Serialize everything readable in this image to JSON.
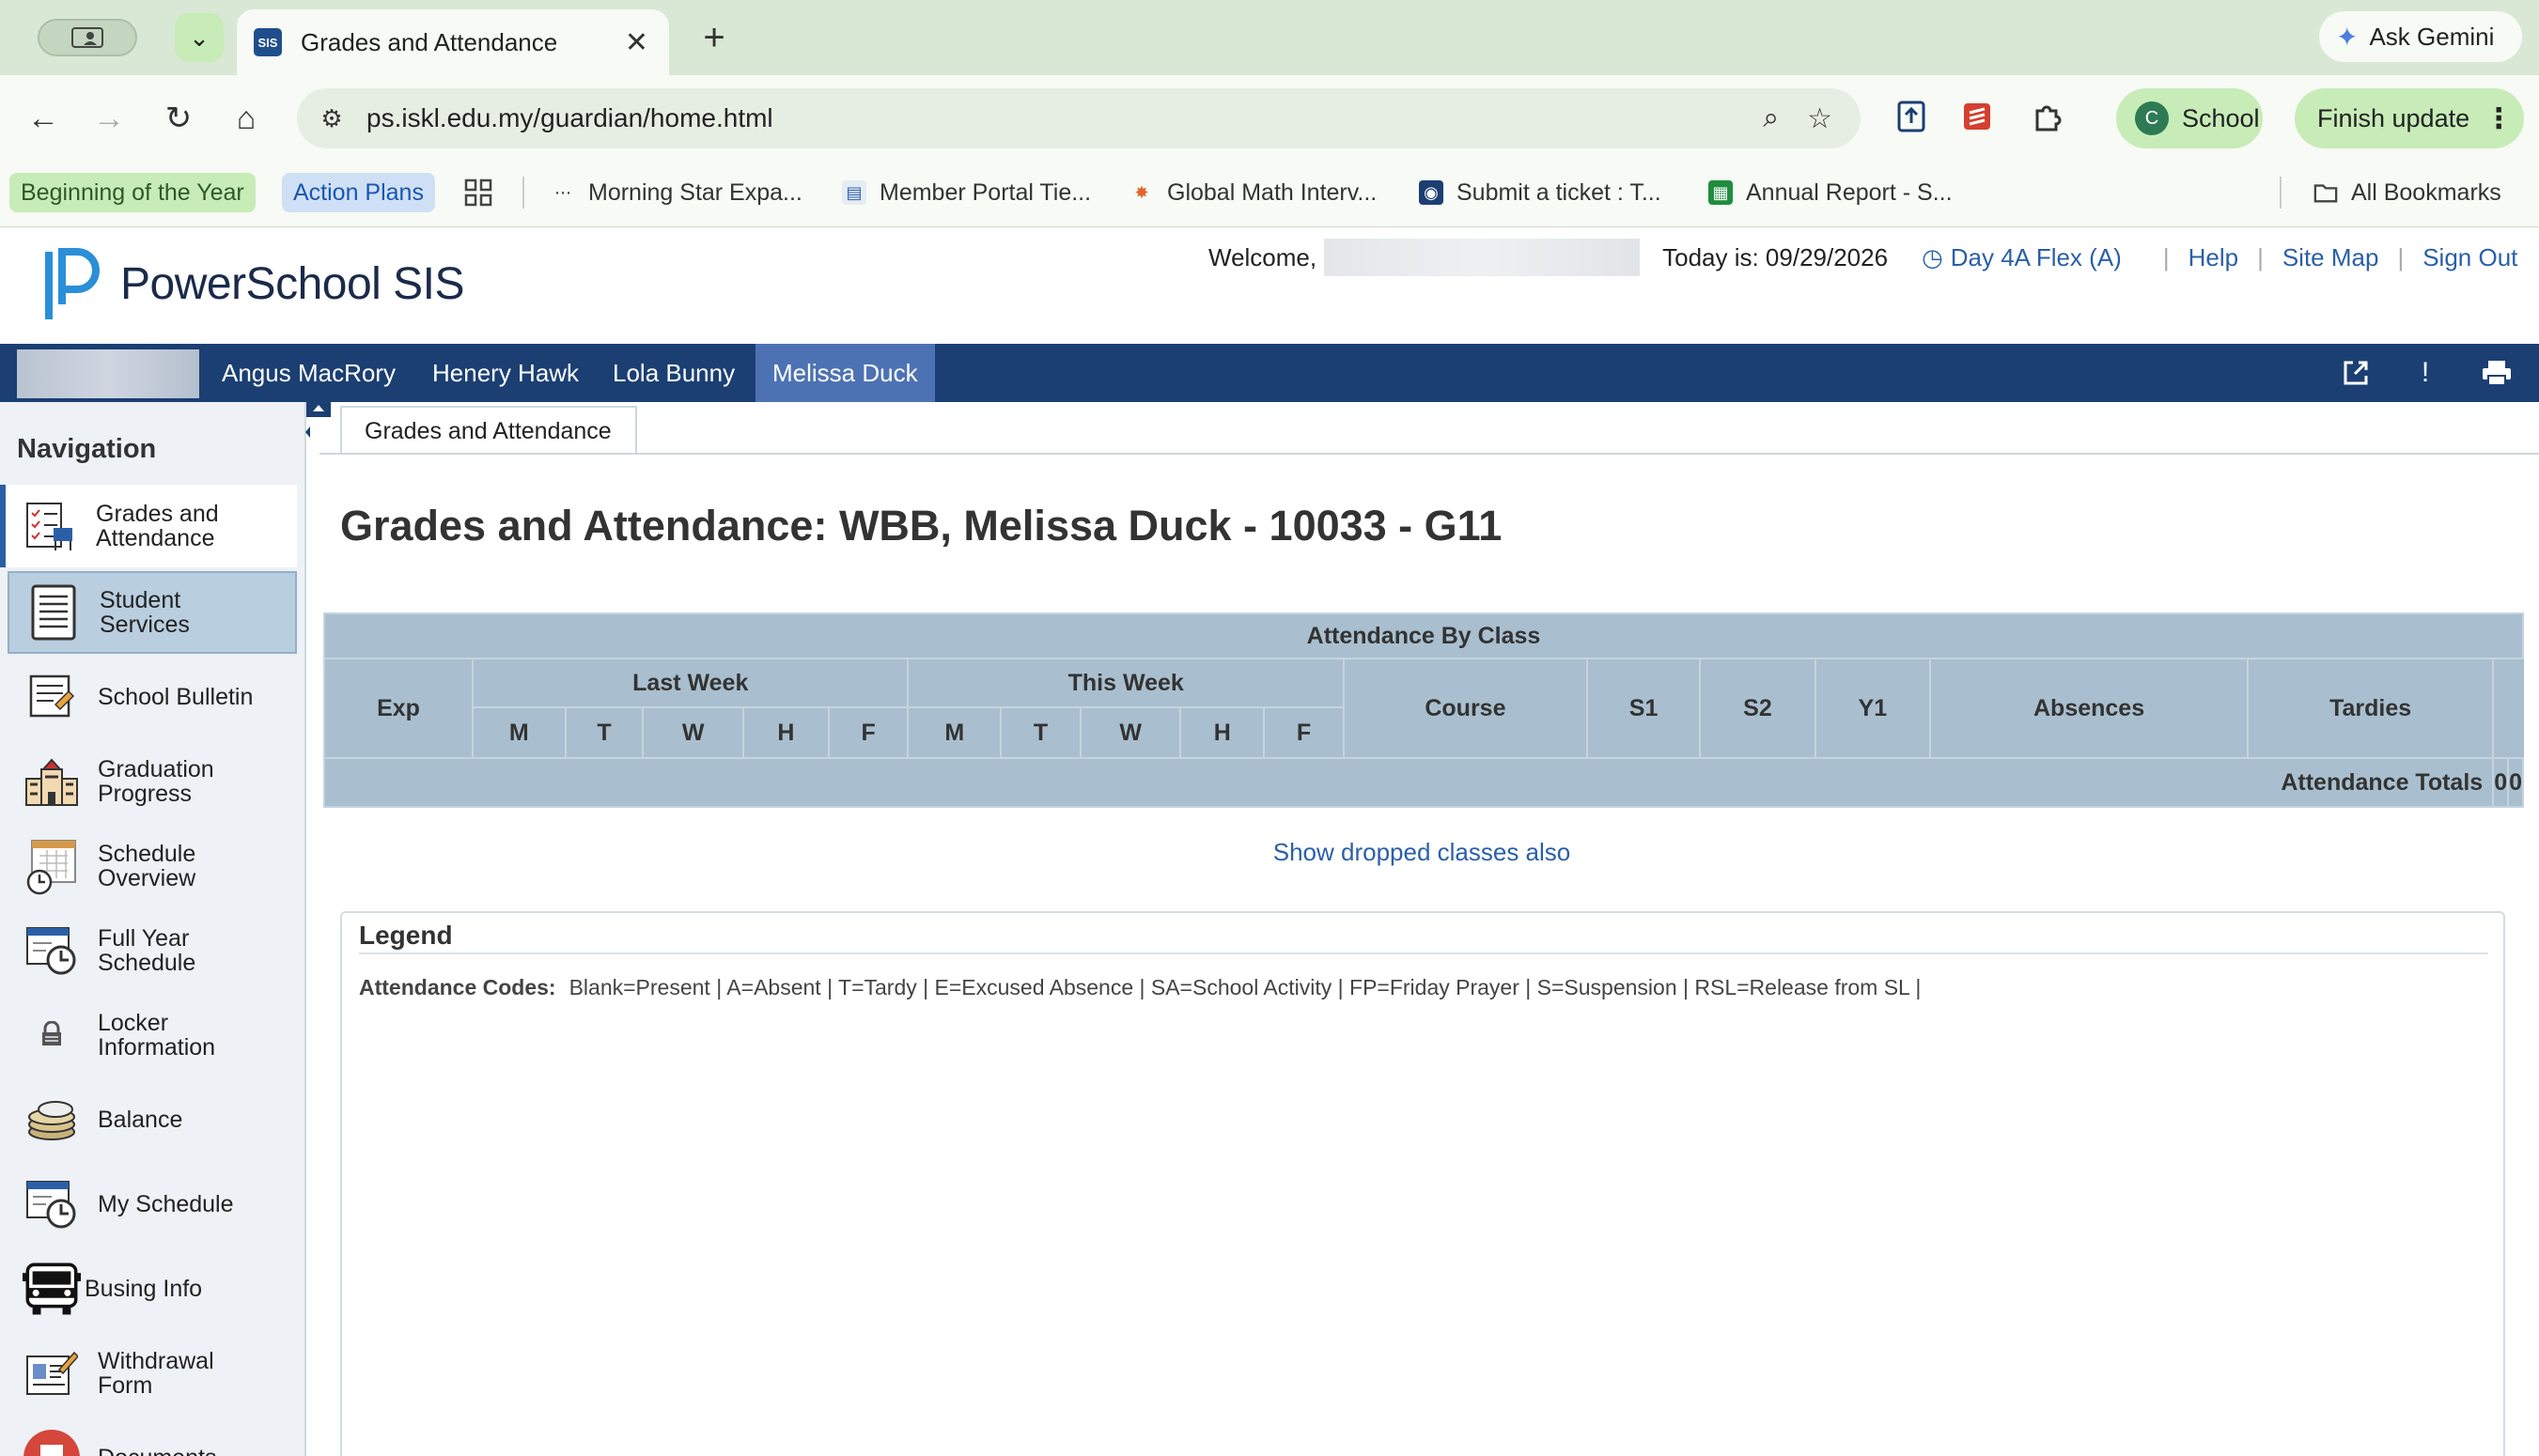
{
  "browser": {
    "tab_title": "Grades and Attendance",
    "favicon_text": "SIS",
    "ask_gemini": "Ask Gemini",
    "url": "ps.iskl.edu.my/guardian/home.html",
    "profile_label": "School",
    "profile_initial": "C",
    "finish_update": "Finish update",
    "bookmarks": [
      {
        "label": "Beginning of the Year"
      },
      {
        "label": "Action Plans"
      },
      {
        "label": "Morning Star Expa..."
      },
      {
        "label": "Member Portal Tie..."
      },
      {
        "label": "Global Math Interv..."
      },
      {
        "label": "Submit a ticket : T..."
      },
      {
        "label": "Annual Report - S..."
      },
      {
        "label": "All Bookmarks"
      }
    ]
  },
  "header": {
    "logo_text": "PowerSchool SIS",
    "welcome": "Welcome,",
    "today": "Today is: 09/29/2026",
    "day": "Day 4A Flex (A)",
    "help": "Help",
    "site_map": "Site Map",
    "sign_out": "Sign Out"
  },
  "students": [
    "Angus MacRory",
    "Henery Hawk",
    "Lola Bunny",
    "Melissa Duck"
  ],
  "navigation": {
    "title": "Navigation",
    "items": [
      {
        "line1": "Grades and",
        "line2": "Attendance"
      },
      {
        "line1": "Student",
        "line2": "Services"
      },
      {
        "line1": "School Bulletin",
        "line2": ""
      },
      {
        "line1": "Graduation",
        "line2": "Progress"
      },
      {
        "line1": "Schedule",
        "line2": "Overview"
      },
      {
        "line1": "Full Year",
        "line2": "Schedule"
      },
      {
        "line1": "Locker",
        "line2": "Information"
      },
      {
        "line1": "Balance",
        "line2": ""
      },
      {
        "line1": "My Schedule",
        "line2": ""
      },
      {
        "line1": "Busing Info",
        "line2": ""
      },
      {
        "line1": "Withdrawal",
        "line2": "Form"
      },
      {
        "line1": "Documents",
        "line2": ""
      }
    ]
  },
  "main": {
    "tab": "Grades and Attendance",
    "title": "Grades and Attendance: WBB, Melissa Duck - 10033 - G11",
    "table": {
      "caption": "Attendance By Class",
      "exp": "Exp",
      "last_week": "Last Week",
      "this_week": "This Week",
      "days": [
        "M",
        "T",
        "W",
        "H",
        "F"
      ],
      "course": "Course",
      "s1": "S1",
      "s2": "S2",
      "y1": "Y1",
      "absences": "Absences",
      "tardies": "Tardies",
      "totals_label": "Attendance Totals",
      "absences_total": "0",
      "tardies_total": "0"
    },
    "show_dropped": "Show dropped classes also",
    "legend": {
      "title": "Legend",
      "codes_label": "Attendance Codes:",
      "codes": "Blank=Present | A=Absent | T=Tardy | E=Excused Absence | SA=School Activity | FP=Friday Prayer | S=Suspension | RSL=Release from SL |"
    }
  },
  "colors": {
    "brand_blue": "#1b3f73",
    "active_student": "#4d72b4",
    "table_header": "#a9bfcf",
    "link": "#2a5fa8"
  }
}
